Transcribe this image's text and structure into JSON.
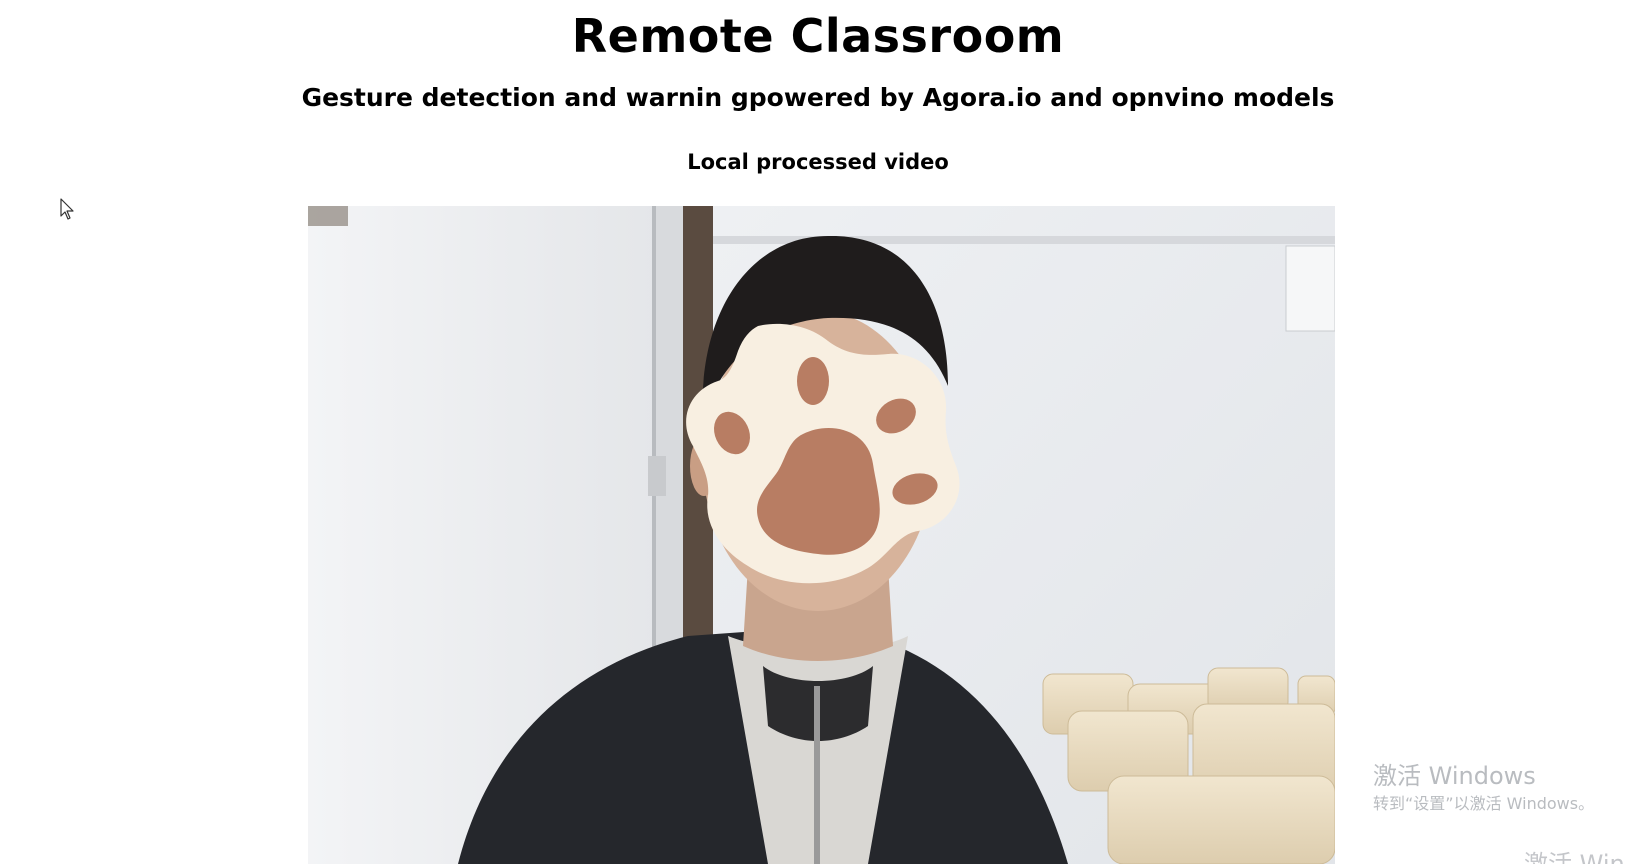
{
  "header": {
    "title": "Remote Classroom",
    "subtitle": "Gesture detection and warnin gpowered by Agora.io and opnvino models"
  },
  "video": {
    "heading": "Local processed video",
    "overlay_icon": "paw-print-icon"
  },
  "os_watermark": {
    "title": "激活 Windows",
    "subtitle": "转到“设置”以激活 Windows。",
    "repeat": "激活 Win"
  },
  "cursor_icon": "mouse-pointer-icon",
  "colors": {
    "paw_fill": "#f8efe1",
    "paw_pads": "#b87d63",
    "jacket": "#25272c",
    "wall": "#eceef1"
  }
}
